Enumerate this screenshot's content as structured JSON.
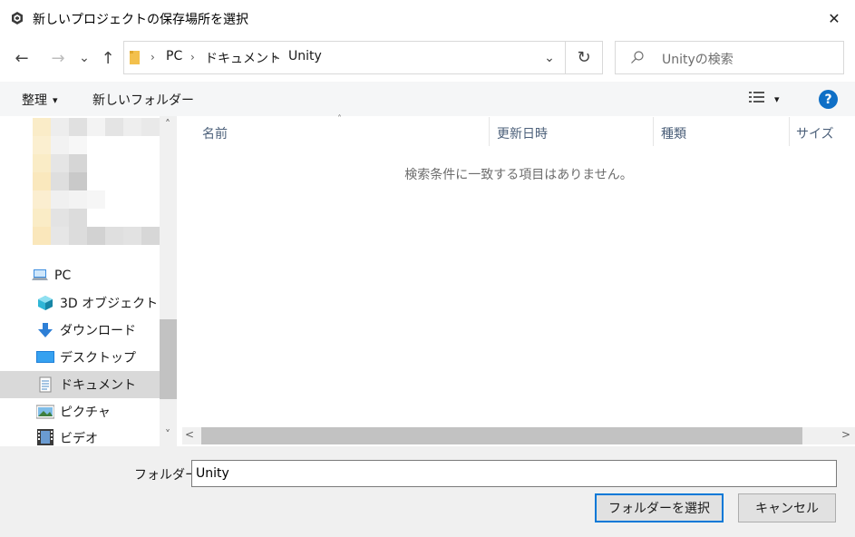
{
  "window": {
    "title": "新しいプロジェクトの保存場所を選択",
    "close_glyph": "✕",
    "app_icon": "unity-icon"
  },
  "nav": {
    "back_glyph": "←",
    "forward_glyph": "→",
    "recent_glyph": "⌄",
    "up_glyph": "↑",
    "breadcrumbs": [
      "PC",
      "ドキュメント",
      "Unity"
    ],
    "separator_glyph": "›",
    "dropdown_glyph": "⌄",
    "refresh_glyph": "↻"
  },
  "search": {
    "placeholder": "Unityの検索"
  },
  "toolbar": {
    "organize_label": "整理",
    "organize_caret": "▾",
    "new_folder_label": "新しいフォルダー",
    "view_caret": "▾",
    "help_glyph": "?"
  },
  "navpane": {
    "items": [
      {
        "label": "PC",
        "icon": "computer-icon"
      },
      {
        "label": "3D オブジェクト",
        "icon": "3d-objects-icon"
      },
      {
        "label": "ダウンロード",
        "icon": "download-icon"
      },
      {
        "label": "デスクトップ",
        "icon": "desktop-icon"
      },
      {
        "label": "ドキュメント",
        "icon": "documents-icon",
        "selected": true
      },
      {
        "label": "ピクチャ",
        "icon": "pictures-icon"
      },
      {
        "label": "ビデオ",
        "icon": "videos-icon"
      }
    ],
    "scroll_up_glyph": "˄",
    "scroll_down_glyph": "˅"
  },
  "filelist": {
    "columns": [
      "名前",
      "更新日時",
      "種類",
      "サイズ"
    ],
    "sort_glyph": "˄",
    "empty_message": "検索条件に一致する項目はありません。",
    "scroll_left_glyph": "<",
    "scroll_right_glyph": ">"
  },
  "footer": {
    "folder_label": "フォルダー:",
    "folder_value": "Unity",
    "select_button": "フォルダーを選択",
    "cancel_button": "キャンセル"
  },
  "colors": {
    "accent": "#0078d7",
    "help_blue": "#0f6fc6",
    "selected_bg": "#d9d9d9",
    "bottom_bg": "#f0f0f0"
  }
}
